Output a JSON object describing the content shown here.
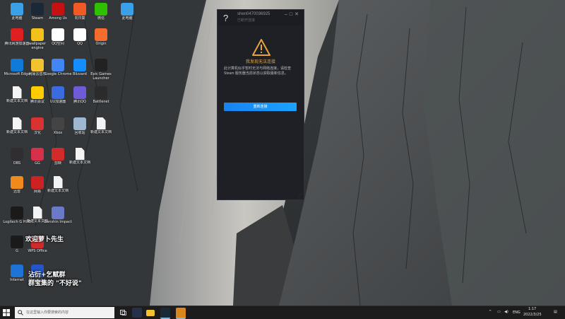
{
  "desktop": {
    "icons": [
      {
        "label": "此电脑",
        "icon": "computer-icon",
        "color": "#3aa0e8"
      },
      {
        "label": "Steam",
        "icon": "steam-icon",
        "color": "#1b2838"
      },
      {
        "label": "Among Us",
        "icon": "among-us-icon",
        "color": "#c51111"
      },
      {
        "label": "向日葵",
        "icon": "sunlogin-icon",
        "color": "#f15a24"
      },
      {
        "label": "微信",
        "icon": "wechat-icon",
        "color": "#2dc100"
      },
      {
        "label": "此电脑",
        "icon": "desktop-icon",
        "color": "#3aa0e8"
      },
      {
        "label": "腾讯网游加速器",
        "icon": "accelerator-icon",
        "color": "#e02020"
      },
      {
        "label": "wallpaper engine",
        "icon": "wallpaper-engine-icon",
        "color": "#f3c11b"
      },
      {
        "label": "QQ空间",
        "icon": "qzone-icon",
        "color": "#ffffff"
      },
      {
        "label": "QQ",
        "icon": "qq-icon",
        "color": "#ffffff"
      },
      {
        "label": "Origin",
        "icon": "origin-icon",
        "color": "#f56c2d"
      },
      {
        "label": "Microsoft Edge",
        "icon": "edge-icon",
        "color": "#0f7ad8"
      },
      {
        "label": "网易云音乐",
        "icon": "music-icon",
        "color": "#f2c230"
      },
      {
        "label": "Google Chrome",
        "icon": "chrome-icon",
        "color": "#4285f4"
      },
      {
        "label": "Blizzard",
        "icon": "blizzard-icon",
        "color": "#148eff"
      },
      {
        "label": "Epic Games Launcher",
        "icon": "epic-games-icon",
        "color": "#222222"
      },
      {
        "label": "新建文本文档",
        "icon": "document-icon",
        "color": "#f4f4f4"
      },
      {
        "label": "腾讯会议",
        "icon": "meeting-icon",
        "color": "#ffcc00"
      },
      {
        "label": "UU加速器",
        "icon": "uu-icon",
        "color": "#3a6ce0"
      },
      {
        "label": "腾讯QQ",
        "icon": "qq-app-icon",
        "color": "#6f5bd8"
      },
      {
        "label": "Battlenet",
        "icon": "battlenet-icon",
        "color": "#2b2b2b"
      },
      {
        "label": "新建文本文档",
        "icon": "document-icon",
        "color": "#f4f4f4"
      },
      {
        "label": "汉化",
        "icon": "chinese-icon",
        "color": "#d93232"
      },
      {
        "label": "Xbox",
        "icon": "xbox-icon",
        "color": "#444444"
      },
      {
        "label": "回收站",
        "icon": "recycle-bin-icon",
        "color": "#9db8d0"
      },
      {
        "label": "新建文本文档",
        "icon": "document-icon",
        "color": "#f4f4f4"
      },
      {
        "label": "OBS",
        "icon": "obs-icon",
        "color": "#302e31"
      },
      {
        "label": "GG",
        "icon": "gg-icon",
        "color": "#d6304a"
      },
      {
        "label": "剪映",
        "icon": "video-editor-icon",
        "color": "#d32b2b"
      },
      {
        "label": "新建文本文档",
        "icon": "document-icon",
        "color": "#f4f4f4"
      },
      {
        "label": "迅雷",
        "icon": "thunder-icon",
        "color": "#f08a1c"
      },
      {
        "label": "网易",
        "icon": "netease-icon",
        "color": "#cc2222"
      },
      {
        "label": "新建文本文档",
        "icon": "document-icon",
        "color": "#f4f4f4"
      },
      {
        "label": "Logitech G HUB",
        "icon": "logitech-icon",
        "color": "#1a1a1a"
      },
      {
        "label": "新建文本文档",
        "icon": "document-icon",
        "color": "#f4f4f4"
      },
      {
        "label": "Genshin Impact",
        "icon": "genshin-icon",
        "color": "#6a7ac8"
      },
      {
        "label": "G",
        "icon": "ghub-icon",
        "color": "#1a1a1a"
      },
      {
        "label": "WPS Office",
        "icon": "wps-icon",
        "color": "#d12a2a"
      },
      {
        "label": "Internet",
        "icon": "internet-icon",
        "color": "#1d73d6"
      },
      {
        "label": "Steam++",
        "icon": "steamplus-icon",
        "color": "#2456c8"
      }
    ],
    "stickers": {
      "line1": "欢迎萝卜先生",
      "line2": "沾衍+乞赋群",
      "line3": "群宝集的 \"不好说\""
    }
  },
  "steam_window": {
    "account": "shen0470036925",
    "status": "已断开连接",
    "error_title": "我发现无法连接",
    "message": "此计算机似乎暂时无法与网络连接，请检查 Steam 服务器当前状态以获取最新信息。",
    "retry_button": "重新连接",
    "help_icon": "?",
    "colors": {
      "warning": "#e6a43a",
      "button": "#1a9fff"
    }
  },
  "taskbar": {
    "search_placeholder": "在这里输入你要搜索的内容",
    "language": "ENG",
    "time": "1:17",
    "date": "2022/3/25"
  }
}
